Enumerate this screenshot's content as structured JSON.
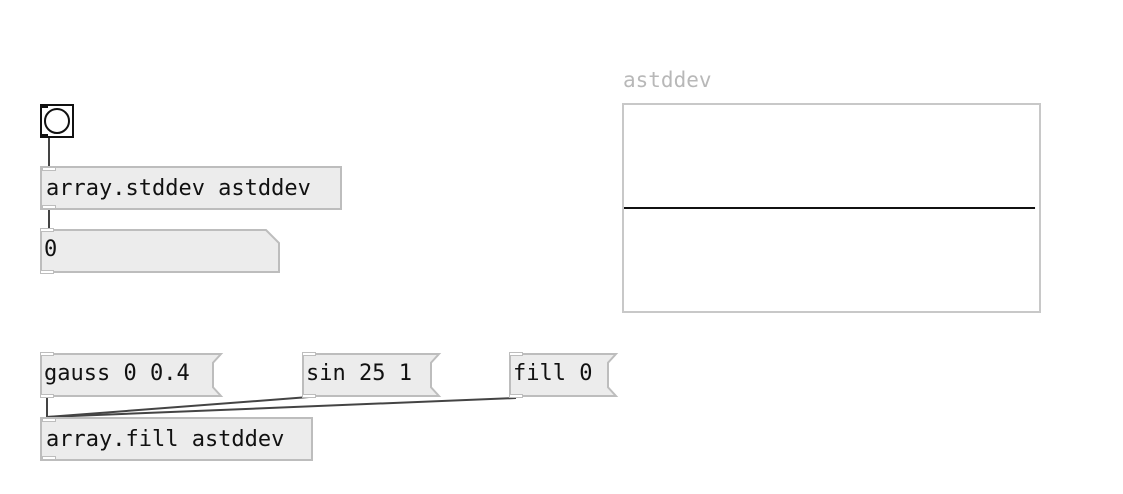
{
  "patch": {
    "bang": {
      "icon": "bang-icon"
    },
    "objects": {
      "stddev": "array.stddev astddev",
      "fill": "array.fill astddev"
    },
    "number_box": {
      "value": "0"
    },
    "messages": {
      "gauss": "gauss 0 0.4",
      "sin": "sin 25 1",
      "fill": "fill 0"
    },
    "graph": {
      "name": "astddev",
      "plot_level": 0
    }
  },
  "colors": {
    "box_fill": "#ececec",
    "box_border": "#bdbdbd",
    "wire": "#444444",
    "graph_label": "#b8b8b8",
    "graph_border": "#c8c8c8",
    "plot_line": "#111111"
  }
}
